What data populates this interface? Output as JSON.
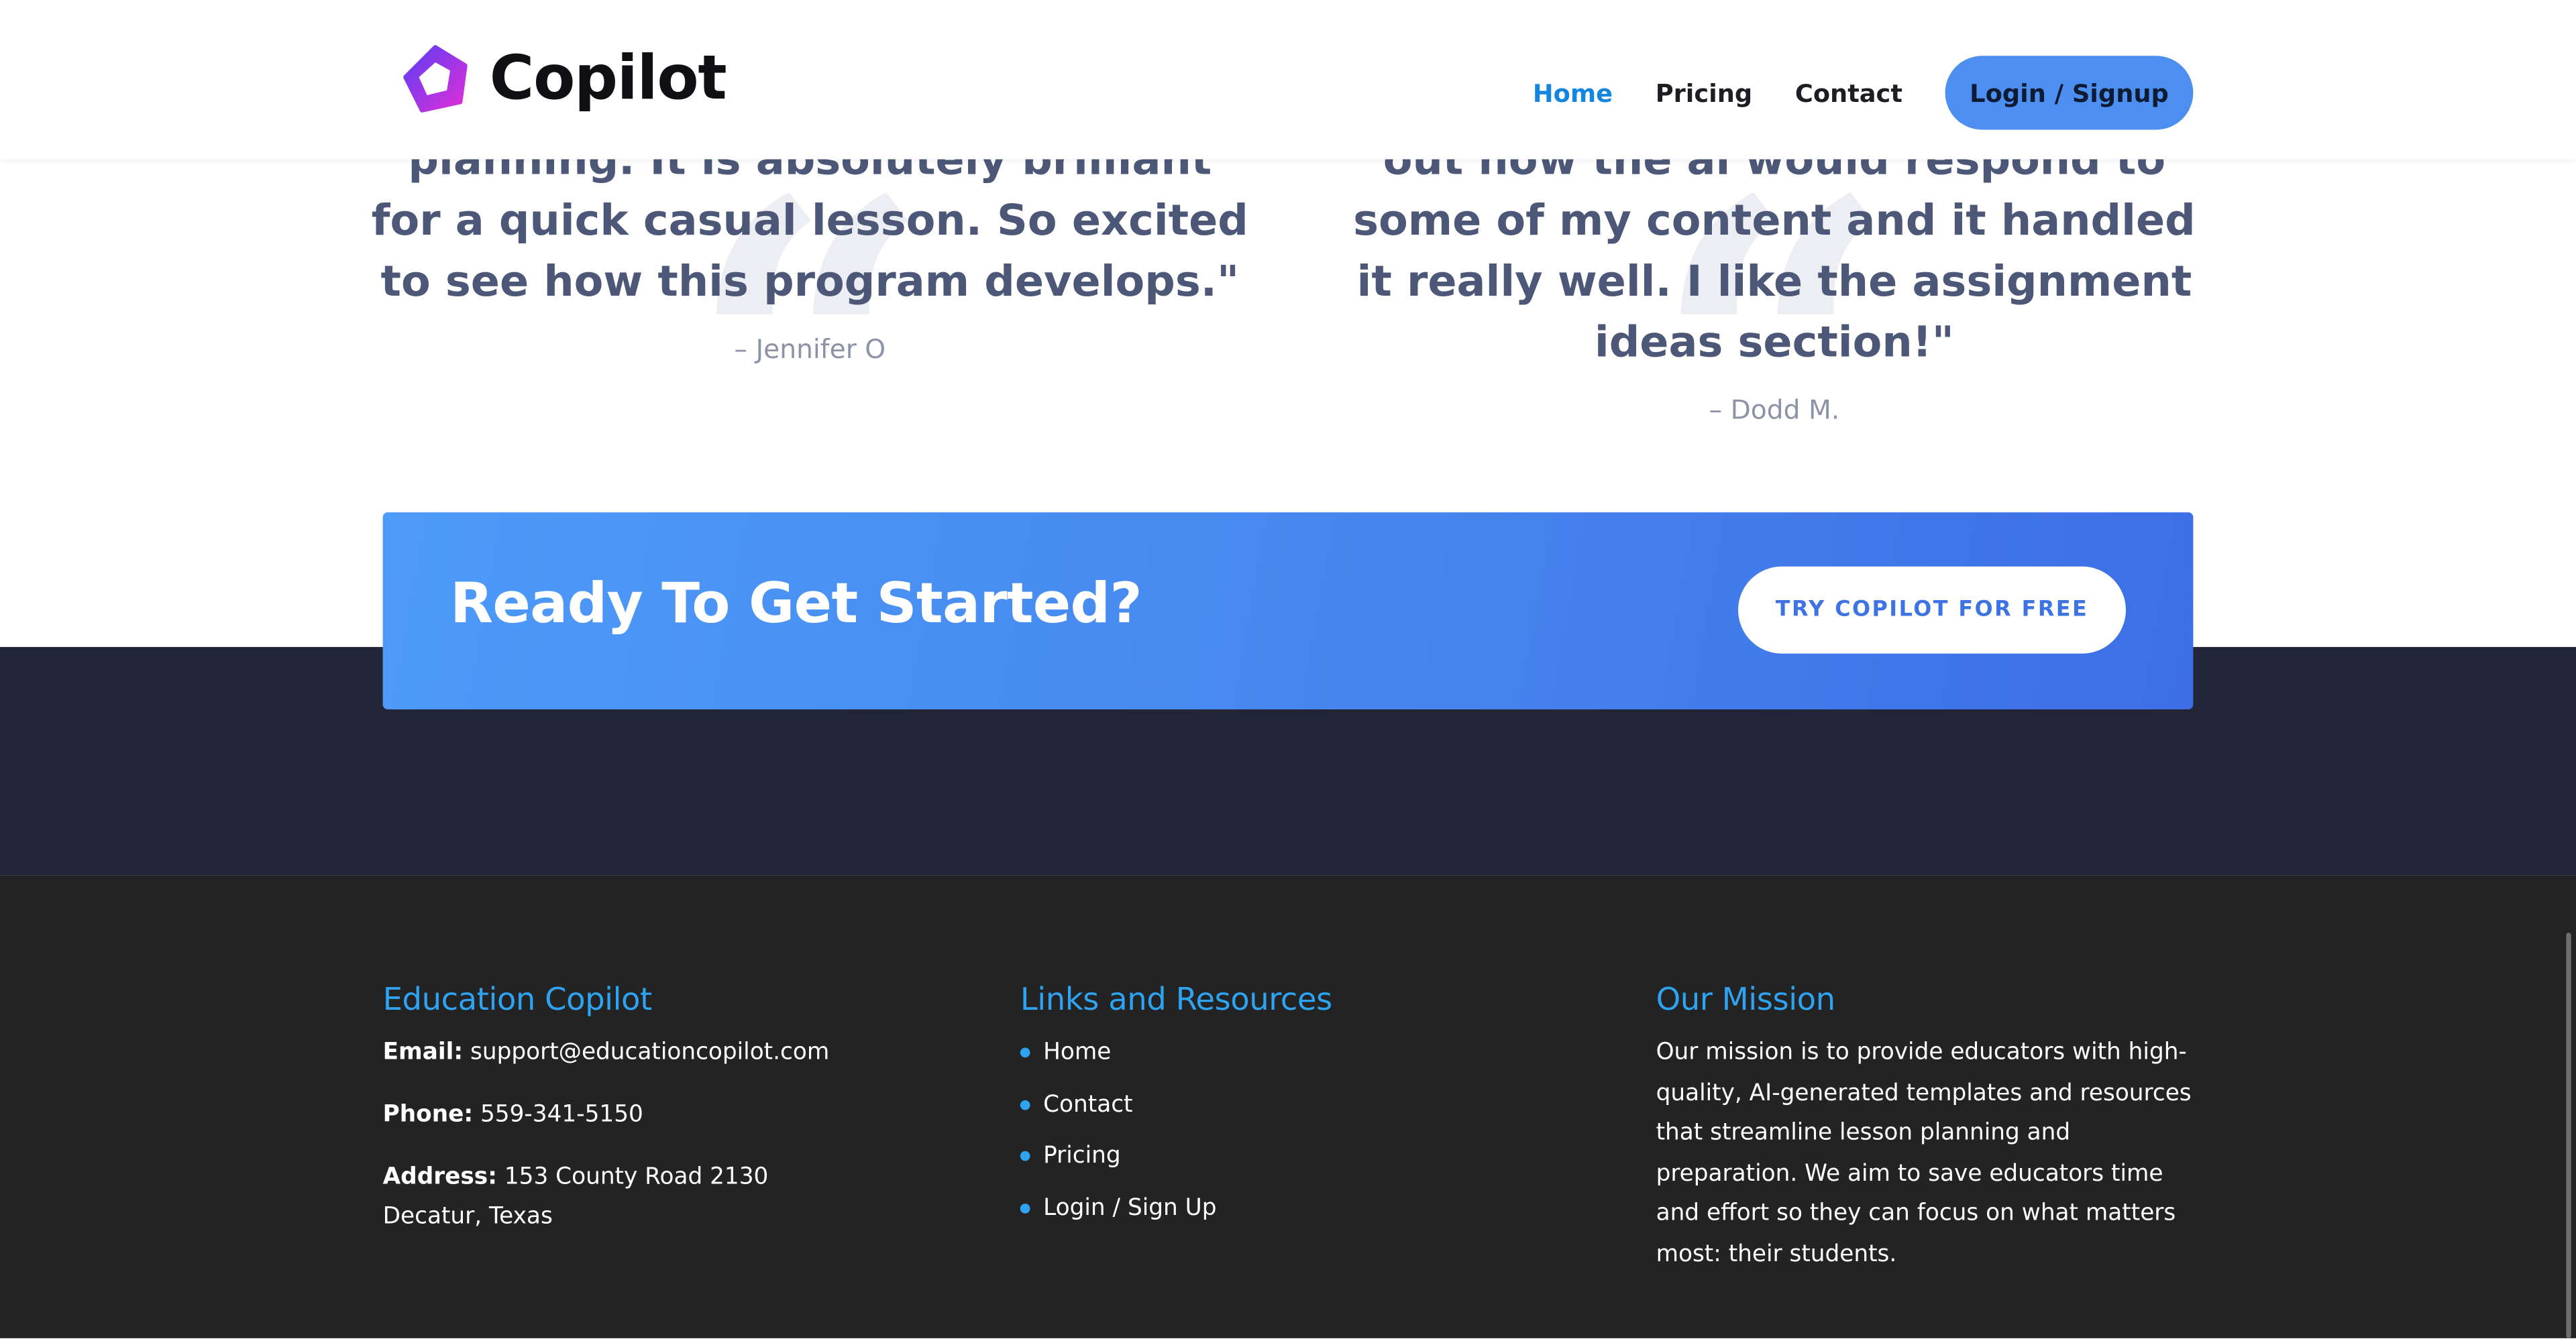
{
  "brand": {
    "name": "Copilot",
    "logo_icon": "pentagon-gradient-logo-icon",
    "colors": {
      "primary": "#4d8ff0",
      "accent_blue": "#1586df",
      "logo_purple": "#7b3cf0",
      "logo_magenta": "#d62fe0"
    }
  },
  "nav": {
    "items": [
      {
        "label": "Home",
        "active": true
      },
      {
        "label": "Pricing",
        "active": false
      },
      {
        "label": "Contact",
        "active": false
      }
    ],
    "cta_label": "Login / Signup"
  },
  "testimonials": [
    {
      "text": "planning. It is absolutely brilliant for a quick casual lesson. So excited to see how this program develops.\"",
      "author": "– Jennifer O"
    },
    {
      "text": "out how the ai would respond to some of my content and it handled it really well. I like the assignment ideas section!\"",
      "author": "– Dodd M."
    }
  ],
  "cta": {
    "title": "Ready To Get Started?",
    "button_label": "TRY COPILOT FOR FREE"
  },
  "footer": {
    "about": {
      "heading": "Education Copilot",
      "email_label": "Email:",
      "email": "support@educationcopilot.com",
      "phone_label": "Phone:",
      "phone": "559-341-5150",
      "address_label": "Address:",
      "address_line1": "153 County Road 2130",
      "address_line2": "Decatur, Texas"
    },
    "links": {
      "heading": "Links and Resources",
      "items": [
        "Home",
        "Contact",
        "Pricing",
        "Login / Sign Up"
      ]
    },
    "mission": {
      "heading": "Our Mission",
      "text": "Our mission is to provide educators with high-quality, AI-generated templates and resources that streamline lesson planning and preparation. We aim to save educators time and effort so they can focus on what matters most: their students."
    }
  }
}
